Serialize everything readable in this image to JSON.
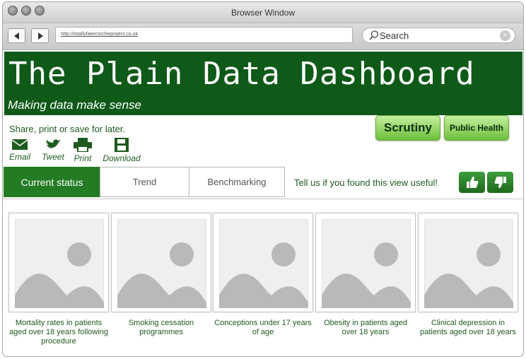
{
  "window": {
    "title": "Browser Window"
  },
  "toolbar": {
    "back_icon": "back-arrow-icon",
    "forward_icon": "forward-arrow-icon",
    "url": "http://totallyfakeclocheproject.co.uk",
    "search_placeholder": "Search"
  },
  "banner": {
    "title": "The Plain Data Dashboard",
    "subtitle": "Making data make sense",
    "color": "#0f5a19"
  },
  "share": {
    "prompt": "Share, print or save for later.",
    "items": [
      {
        "label": "Email",
        "icon": "envelope-icon"
      },
      {
        "label": "Tweet",
        "icon": "bird-icon"
      },
      {
        "label": "Print",
        "icon": "printer-icon"
      },
      {
        "label": "Download",
        "icon": "floppy-disk-icon"
      }
    ]
  },
  "buttons": {
    "scrutiny": "Scrutiny",
    "public_health": "Public Health"
  },
  "tabs": [
    {
      "label": "Current status",
      "active": true
    },
    {
      "label": "Trend",
      "active": false
    },
    {
      "label": "Benchmarking",
      "active": false
    }
  ],
  "feedback": {
    "text": "Tell us if you found this view useful!",
    "up_icon": "thumbs-up-icon",
    "down_icon": "thumbs-down-icon"
  },
  "cards": [
    {
      "caption": "Mortality rates in patients aged over 18 years following procedure"
    },
    {
      "caption": "Smoking cessation programmes"
    },
    {
      "caption": "Conceptions under 17 years of age"
    },
    {
      "caption": "Obesity in patients aged over 18 years"
    },
    {
      "caption": "Clinical depression in patients aged over 18 years"
    }
  ],
  "colors": {
    "accent": "#237c23",
    "text_green": "#1f5a1f",
    "button_green": "#6cbf3a"
  }
}
